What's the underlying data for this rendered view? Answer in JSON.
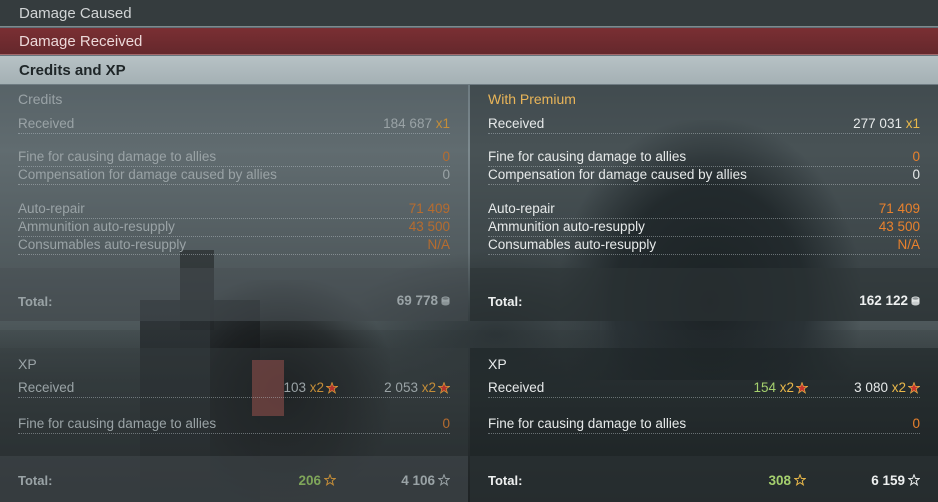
{
  "tabs": {
    "damage_caused": "Damage Caused",
    "damage_received": "Damage Received",
    "credits_xp": "Credits and XP"
  },
  "credits": {
    "standard": {
      "title": "Credits",
      "received_label": "Received",
      "received_value": "184 687",
      "received_mult": "x1",
      "fine_label": "Fine for causing damage to allies",
      "fine_value": "0",
      "comp_label": "Compensation for damage caused by allies",
      "comp_value": "0",
      "repair_label": "Auto-repair",
      "repair_value": "71 409",
      "ammo_label": "Ammunition auto-resupply",
      "ammo_value": "43 500",
      "cons_label": "Consumables auto-resupply",
      "cons_value": "N/A",
      "total_label": "Total:",
      "total_value": "69 778"
    },
    "premium": {
      "title": "With Premium",
      "received_label": "Received",
      "received_value": "277 031",
      "received_mult": "x1",
      "fine_label": "Fine for causing damage to allies",
      "fine_value": "0",
      "comp_label": "Compensation for damage caused by allies",
      "comp_value": "0",
      "repair_label": "Auto-repair",
      "repair_value": "71 409",
      "ammo_label": "Ammunition auto-resupply",
      "ammo_value": "43 500",
      "cons_label": "Consumables auto-resupply",
      "cons_value": "N/A",
      "total_label": "Total:",
      "total_value": "162 122"
    }
  },
  "xp": {
    "standard": {
      "title": "XP",
      "received_label": "Received",
      "ship_xp": "103",
      "ship_mult": "x2",
      "xp": "2 053",
      "xp_mult": "x2",
      "fine_label": "Fine for causing damage to allies",
      "fine_value": "0",
      "total_label": "Total:",
      "total_ship_xp": "206",
      "total_xp": "4 106"
    },
    "premium": {
      "title": "XP",
      "received_label": "Received",
      "ship_xp": "154",
      "ship_mult": "x2",
      "xp": "3 080",
      "xp_mult": "x2",
      "fine_label": "Fine for causing damage to allies",
      "fine_value": "0",
      "total_label": "Total:",
      "total_ship_xp": "308",
      "total_xp": "6 159"
    }
  },
  "icons": {
    "credits": "credits-coin-icon",
    "multiplier_medal": "red-star-medal-icon",
    "ship_xp": "ship-xp-star-icon",
    "xp": "xp-star-icon"
  },
  "colors": {
    "premium_title": "#e9b559",
    "deduction": "#e8812d",
    "ship_xp": "#a5d06e",
    "multiplier": "#e9b84a",
    "active_tab": "#a4b0b4",
    "damage_received_tab": "#6f2b2f"
  }
}
